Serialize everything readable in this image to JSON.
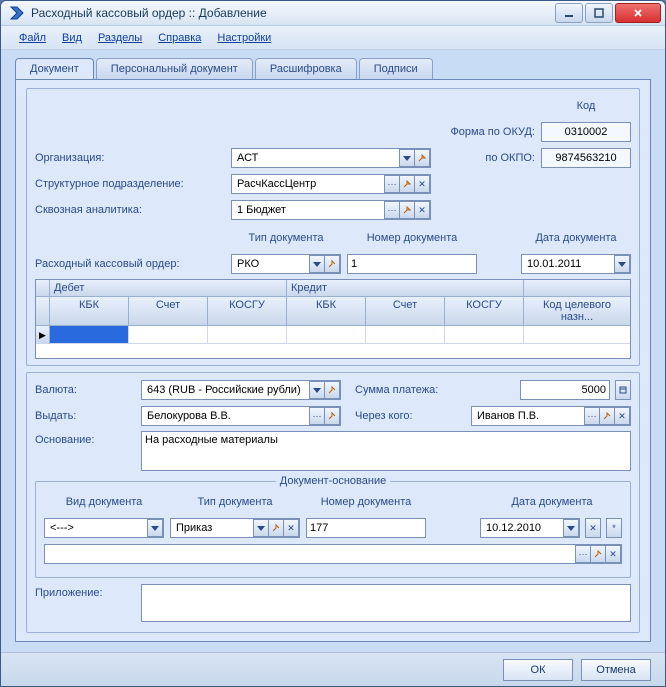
{
  "window": {
    "title": "Расходный кассовый ордер :: Добавление"
  },
  "menu": {
    "file": "Файл",
    "view": "Вид",
    "sections": "Разделы",
    "help": "Справка",
    "settings": "Настройки"
  },
  "tabs": {
    "doc": "Документ",
    "personal": "Персональный документ",
    "decode": "Расшифровка",
    "signs": "Подписи"
  },
  "labels": {
    "code": "Код",
    "okud": "Форма по ОКУД:",
    "okpo": "по ОКПО:",
    "org": "Организация:",
    "struct": "Структурное подразделение:",
    "analytics": "Сквозная аналитика:",
    "doctype": "Тип документа",
    "docnum": "Номер документа",
    "docdate": "Дата документа",
    "rko": "Расходный кассовый ордер:",
    "debit": "Дебет",
    "credit": "Кредит",
    "kbk": "КБК",
    "account": "Счет",
    "kosgu": "КОСГУ",
    "target": "Код целевого назн...",
    "currency": "Валюта:",
    "paysum": "Сумма платежа:",
    "issue": "Выдать:",
    "through": "Через кого:",
    "basis": "Основание:",
    "basisGroup": "Документ-основание",
    "viddoc": "Вид документа",
    "attach": "Приложение:"
  },
  "values": {
    "okud": "0310002",
    "okpo": "9874563210",
    "org": "АСТ",
    "struct": "РасчКассЦентр",
    "analytics": "1 Бюджет",
    "doctype": "РКО",
    "docnum": "1",
    "docdate": "10.01.2011",
    "currency": "643 (RUB - Российские рубли)",
    "paysum": "5000",
    "issue": "Белокурова В.В.",
    "through": "Иванов П.В.",
    "basis": "На расходные материалы",
    "viddoc": "<--->",
    "basistype": "Приказ",
    "basisnum": "177",
    "basisdate": "10.12.2010"
  },
  "footer": {
    "ok": "ОК",
    "cancel": "Отмена"
  }
}
